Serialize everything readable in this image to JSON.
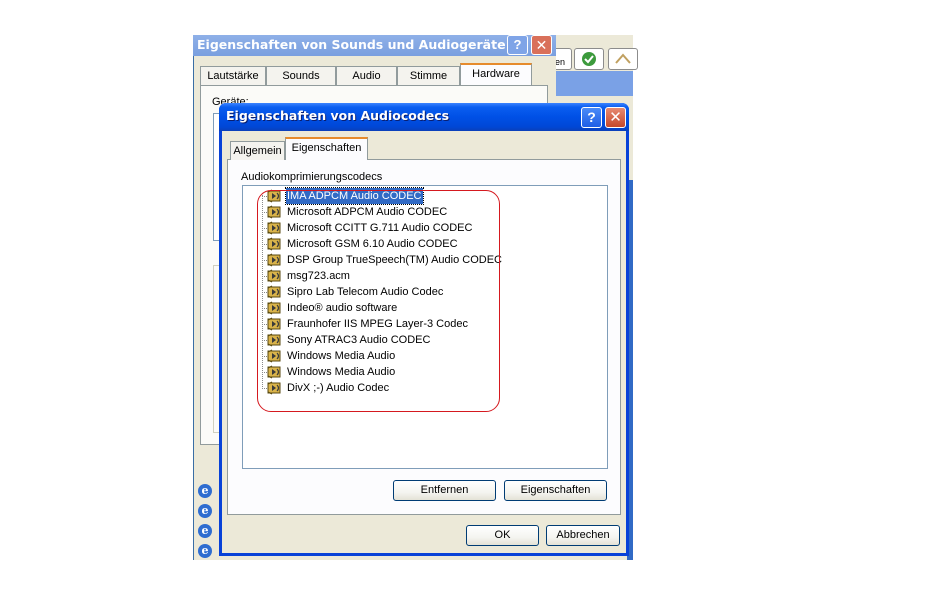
{
  "back_dialog": {
    "title": "Eigenschaften von Sounds und Audiogeräte",
    "help_glyph": "?",
    "close_glyph": "✕",
    "tabs": [
      "Lautstärke",
      "Sounds",
      "Audio",
      "Stimme",
      "Hardware"
    ],
    "devices_label": "Geräte:"
  },
  "front_dialog": {
    "title": "Eigenschaften von Audiocodecs",
    "help_glyph": "?",
    "close_glyph": "✕",
    "tabs": [
      "Allgemein",
      "Eigenschaften"
    ],
    "active_tab": "Eigenschaften",
    "list_label": "Audiokomprimierungscodecs",
    "codecs": [
      "IMA ADPCM  Audio CODEC",
      "Microsoft ADPCM Audio CODEC",
      "Microsoft CCITT G.711 Audio CODEC",
      "Microsoft GSM 6.10  Audio CODEC",
      "DSP Group TrueSpeech(TM) Audio CODEC",
      "msg723.acm",
      "Sipro Lab Telecom Audio Codec",
      "Indeo® audio software",
      "Fraunhofer IIS MPEG Layer-3 Codec",
      "Sony ATRAC3 Audio CODEC",
      "Windows Media Audio",
      "Windows Media Audio",
      "DivX ;-) Audio Codec"
    ],
    "selected_codec": "IMA ADPCM  Audio CODEC",
    "buttons": {
      "remove": "Entfernen",
      "properties": "Eigenschaften",
      "ok": "OK",
      "cancel": "Abbrechen"
    }
  },
  "background": {
    "partial_text": "en"
  },
  "colors": {
    "title_blue": "#0050e6",
    "selection": "#316ac5",
    "annotation_red": "#d5191f",
    "dialog_face": "#ece9d8"
  }
}
